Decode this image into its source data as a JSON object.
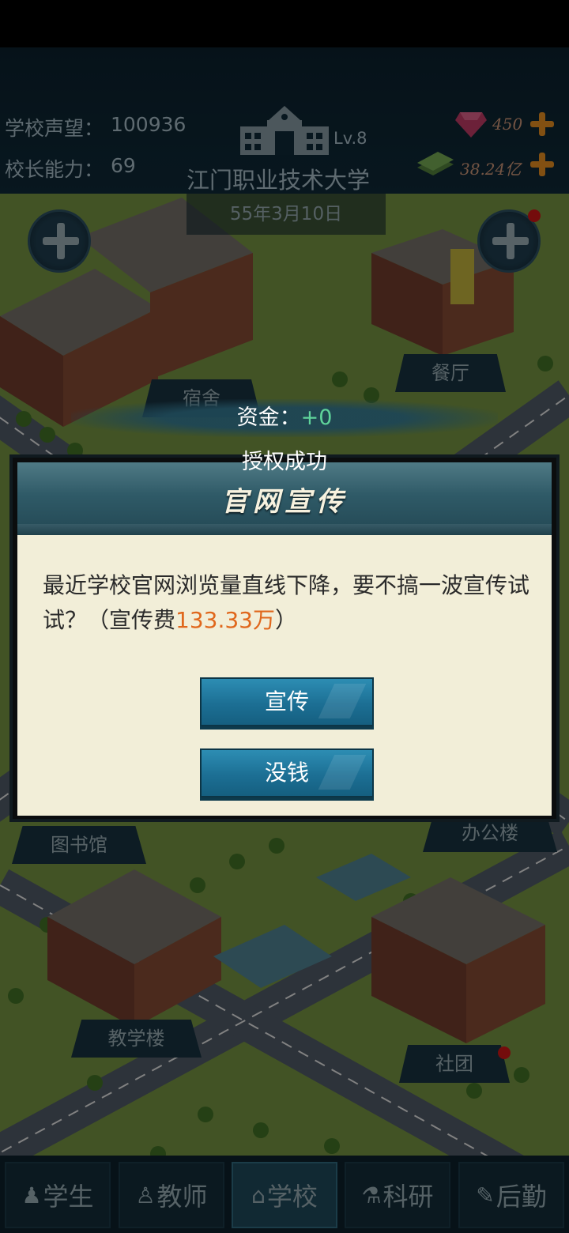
{
  "hud": {
    "reputation_label": "学校声望：",
    "reputation_value": "100936",
    "ability_label": "校长能力：",
    "ability_value": "69",
    "level": "Lv.8",
    "school_name": "江门职业技术大学",
    "gems": "450",
    "money": "38.24亿",
    "date": "55年3月10日"
  },
  "buildings": {
    "dorm": "宿舍",
    "canteen": "餐厅",
    "library": "图书馆",
    "office": "办公楼",
    "teaching": "教学楼",
    "club": "社团"
  },
  "funds": {
    "label": "资金：",
    "value": "+0"
  },
  "dialog": {
    "success": "授权成功",
    "title": "官网宣传",
    "message": "最近学校官网浏览量直线下降，要不搞一波宣传试试？（宣传费",
    "fee": "133.33万",
    "message_end": "）",
    "primary_button": "宣传",
    "secondary_button": "没钱"
  },
  "nav": [
    {
      "label": "学生",
      "icon": "student-icon"
    },
    {
      "label": "教师",
      "icon": "teacher-icon"
    },
    {
      "label": "学校",
      "icon": "school-icon"
    },
    {
      "label": "科研",
      "icon": "research-icon"
    },
    {
      "label": "后勤",
      "icon": "logistics-icon"
    }
  ],
  "colors": {
    "accent_fee": "#e0671c",
    "funds_positive": "#5fd39a",
    "button_blue": "#1c6f94",
    "dialog_body": "#f2eed8"
  }
}
